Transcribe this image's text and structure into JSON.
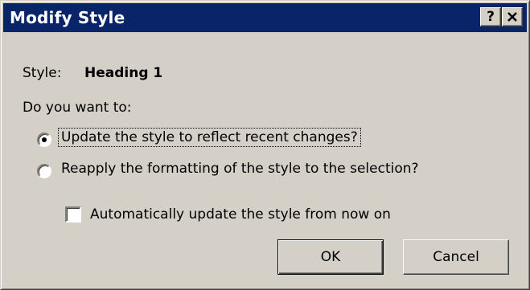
{
  "window": {
    "title": "Modify Style",
    "help_button": "?",
    "close_button": "✕"
  },
  "style": {
    "label": "Style:",
    "value": "Heading 1"
  },
  "prompt": "Do you want to:",
  "options": [
    {
      "label": "Update the style to reflect recent changes?",
      "selected": true
    },
    {
      "label": "Reapply the formatting of the style to the selection?",
      "selected": false
    }
  ],
  "auto_update": {
    "label": "Automatically update the style from now on",
    "checked": false
  },
  "buttons": {
    "ok": "OK",
    "cancel": "Cancel"
  },
  "colors": {
    "titlebar": "#0a246a",
    "face": "#d4d0c8"
  }
}
